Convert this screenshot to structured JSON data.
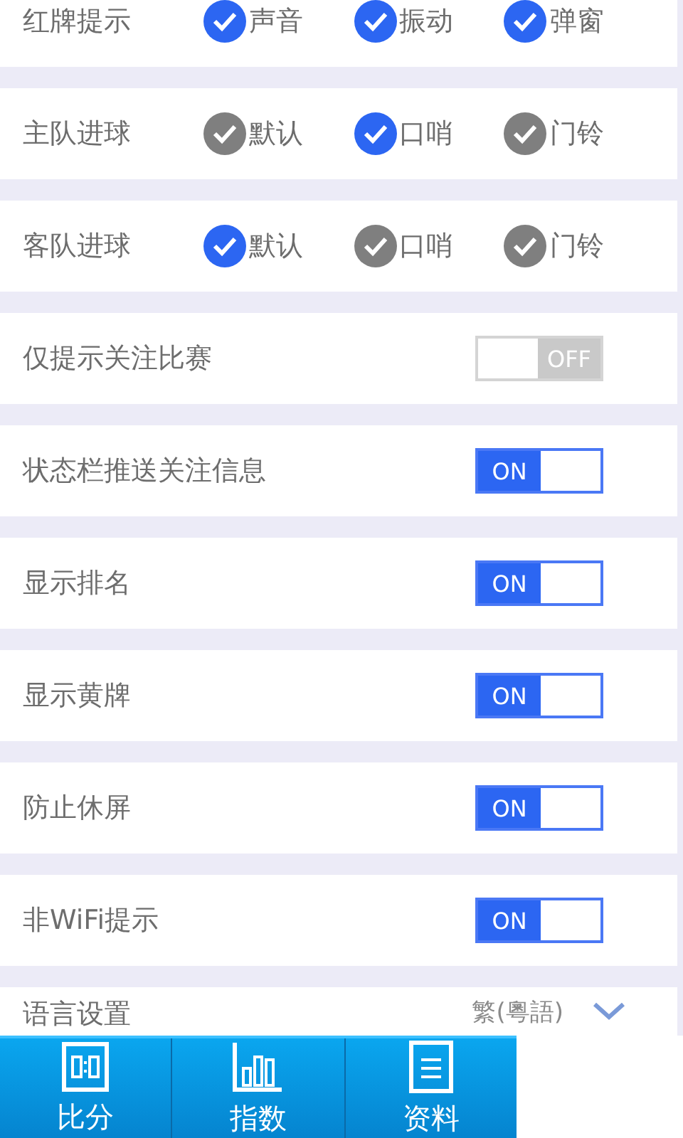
{
  "option_rows": [
    {
      "label": "红牌提示",
      "options": [
        {
          "label": "声音",
          "checked": true
        },
        {
          "label": "振动",
          "checked": true
        },
        {
          "label": "弹窗",
          "checked": true
        }
      ]
    },
    {
      "label": "主队进球",
      "options": [
        {
          "label": "默认",
          "checked": false
        },
        {
          "label": "口哨",
          "checked": true
        },
        {
          "label": "门铃",
          "checked": false
        }
      ]
    },
    {
      "label": "客队进球",
      "options": [
        {
          "label": "默认",
          "checked": true
        },
        {
          "label": "口哨",
          "checked": false
        },
        {
          "label": "门铃",
          "checked": false
        }
      ]
    }
  ],
  "switch_rows": [
    {
      "label": "仅提示关注比赛",
      "on": false,
      "text": "OFF"
    },
    {
      "label": "状态栏推送关注信息",
      "on": true,
      "text": "ON"
    },
    {
      "label": "显示排名",
      "on": true,
      "text": "ON"
    },
    {
      "label": "显示黄牌",
      "on": true,
      "text": "ON"
    },
    {
      "label": "防止休屏",
      "on": true,
      "text": "ON"
    },
    {
      "label": "非WiFi提示",
      "on": true,
      "text": "ON"
    }
  ],
  "language": {
    "label": "语言设置",
    "value": "繁(粵語)"
  },
  "tabs": [
    {
      "label": "比分",
      "kind": "score"
    },
    {
      "label": "指数",
      "kind": "chart"
    },
    {
      "label": "资料",
      "kind": "doc"
    }
  ]
}
